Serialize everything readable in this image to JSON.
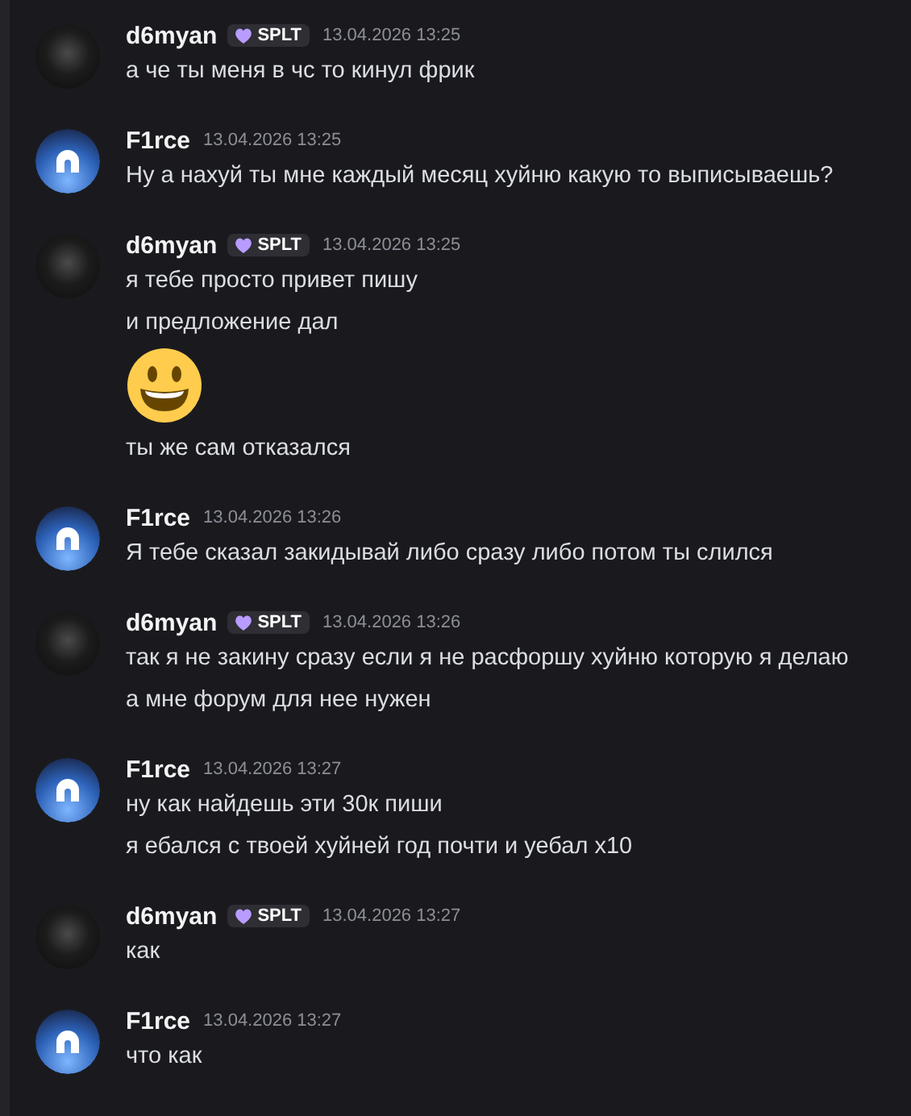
{
  "messages": [
    {
      "author": "d6myan",
      "avatar": {
        "kind": "photo"
      },
      "badge": "SPLT",
      "timestamp": "13.04.2026 13:25",
      "lines": [
        {
          "kind": "text",
          "text": "а че ты меня в чс то кинул фрик"
        }
      ]
    },
    {
      "author": "F1rce",
      "avatar": {
        "kind": "logo"
      },
      "timestamp": "13.04.2026 13:25",
      "lines": [
        {
          "kind": "text",
          "text": "Ну а нахуй ты мне каждый месяц хуйню какую то выписываешь?"
        }
      ]
    },
    {
      "author": "d6myan",
      "avatar": {
        "kind": "photo"
      },
      "badge": "SPLT",
      "timestamp": "13.04.2026 13:25",
      "lines": [
        {
          "kind": "text",
          "text": "я тебе просто привет пишу"
        },
        {
          "kind": "text",
          "text": "и предложение дал"
        },
        {
          "kind": "emoji"
        },
        {
          "kind": "text",
          "text": "ты же сам отказался"
        }
      ]
    },
    {
      "author": "F1rce",
      "avatar": {
        "kind": "logo"
      },
      "timestamp": "13.04.2026 13:26",
      "lines": [
        {
          "kind": "text",
          "text": "Я тебе сказал закидывай либо сразу либо потом ты слился"
        }
      ]
    },
    {
      "author": "d6myan",
      "avatar": {
        "kind": "photo"
      },
      "badge": "SPLT",
      "timestamp": "13.04.2026 13:26",
      "lines": [
        {
          "kind": "text",
          "text": "так я не закину сразу если я не расфоршу хуйню которую я делаю"
        },
        {
          "kind": "text",
          "text": "а мне форум для нее нужен"
        }
      ]
    },
    {
      "author": "F1rce",
      "avatar": {
        "kind": "logo"
      },
      "timestamp": "13.04.2026 13:27",
      "lines": [
        {
          "kind": "text",
          "text": "ну как найдешь эти 30к пиши"
        },
        {
          "kind": "text",
          "text": "я ебался с твоей хуйней год почти и уебал х10"
        }
      ]
    },
    {
      "author": "d6myan",
      "avatar": {
        "kind": "photo"
      },
      "badge": "SPLT",
      "timestamp": "13.04.2026 13:27",
      "lines": [
        {
          "kind": "text",
          "text": "как"
        }
      ]
    },
    {
      "author": "F1rce",
      "avatar": {
        "kind": "logo"
      },
      "timestamp": "13.04.2026 13:27",
      "lines": [
        {
          "kind": "text",
          "text": "что как"
        }
      ]
    }
  ]
}
